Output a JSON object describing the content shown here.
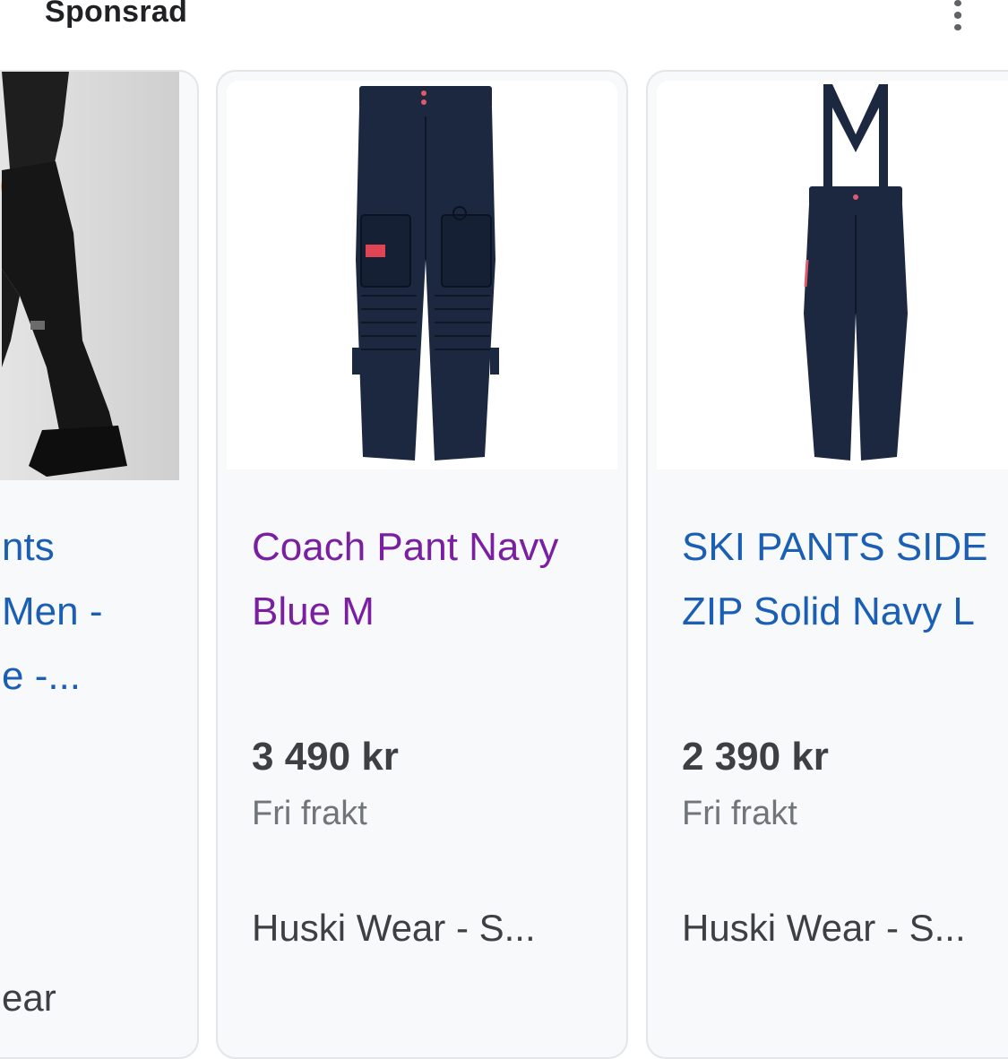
{
  "header": {
    "title": "Sponsrad",
    "menu_icon": "more-vert-icon"
  },
  "products": [
    {
      "title_lines": [
        "nts",
        "Men -",
        "e -..."
      ],
      "seller": "ear",
      "image": "black-snow-pants-photo"
    },
    {
      "title_lines": [
        "Coach Pant Navy",
        "Blue M"
      ],
      "price": "3 490 kr",
      "shipping": "Fri frakt",
      "seller": "Huski Wear - S...",
      "image": "navy-cargo-ski-pants"
    },
    {
      "title_lines": [
        "SKI PANTS SIDE",
        "ZIP Solid Navy L"
      ],
      "price": "2 390 kr",
      "shipping": "Fri frakt",
      "seller": "Huski Wear - S...",
      "image": "navy-ski-pants-with-suspenders"
    }
  ],
  "colors": {
    "visited_link": "#7b1fa2",
    "link": "#1a5fb4",
    "pants_navy": "#1c2740"
  }
}
